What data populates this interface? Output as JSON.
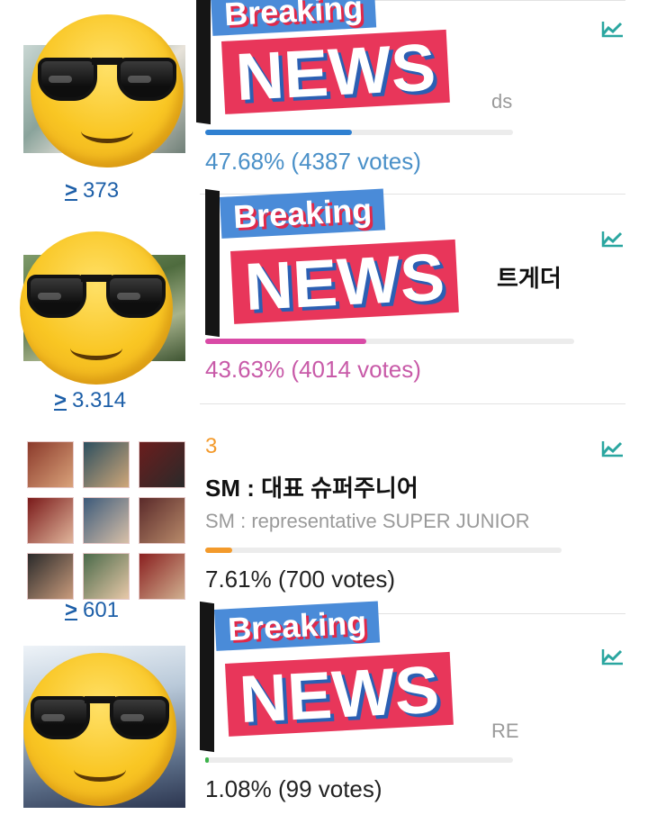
{
  "entries": [
    {
      "rank": "",
      "title": "",
      "subtitle": "ds",
      "percent_text": "47.68% (4387 votes)",
      "percent": 47.68,
      "bar_color": "#2f80d1",
      "text_color": "#4a90c8",
      "badge": "373",
      "overlay": {
        "top": "Breaking",
        "bottom": "NEWS"
      }
    },
    {
      "rank": "",
      "title": "트게더",
      "subtitle": "",
      "percent_text": "43.63% (4014 votes)",
      "percent": 43.63,
      "bar_color": "#d94aa6",
      "text_color": "#c85aa8",
      "badge": "3.314",
      "overlay": {
        "top": "Breaking",
        "bottom": "NEWS"
      }
    },
    {
      "rank": "3",
      "title": "SM : 대표 슈퍼주니어",
      "subtitle": "SM : representative SUPER JUNIOR",
      "percent_text": "7.61% (700 votes)",
      "percent": 7.61,
      "bar_color": "#f39a2b",
      "text_color": "#222222",
      "badge": "601"
    },
    {
      "rank": "",
      "title": "",
      "subtitle": "RE",
      "percent_text": "1.08% (99 votes)",
      "percent": 1.08,
      "bar_color": "#3cb34a",
      "text_color": "#222222",
      "badge": "",
      "overlay": {
        "top": "Breaking",
        "bottom": "NEWS"
      }
    }
  ],
  "icons": {
    "trend": "trend-chart-icon",
    "badge": "upvote-chevron-icon",
    "overlay_emoji": "sunglasses-emoji-icon"
  }
}
